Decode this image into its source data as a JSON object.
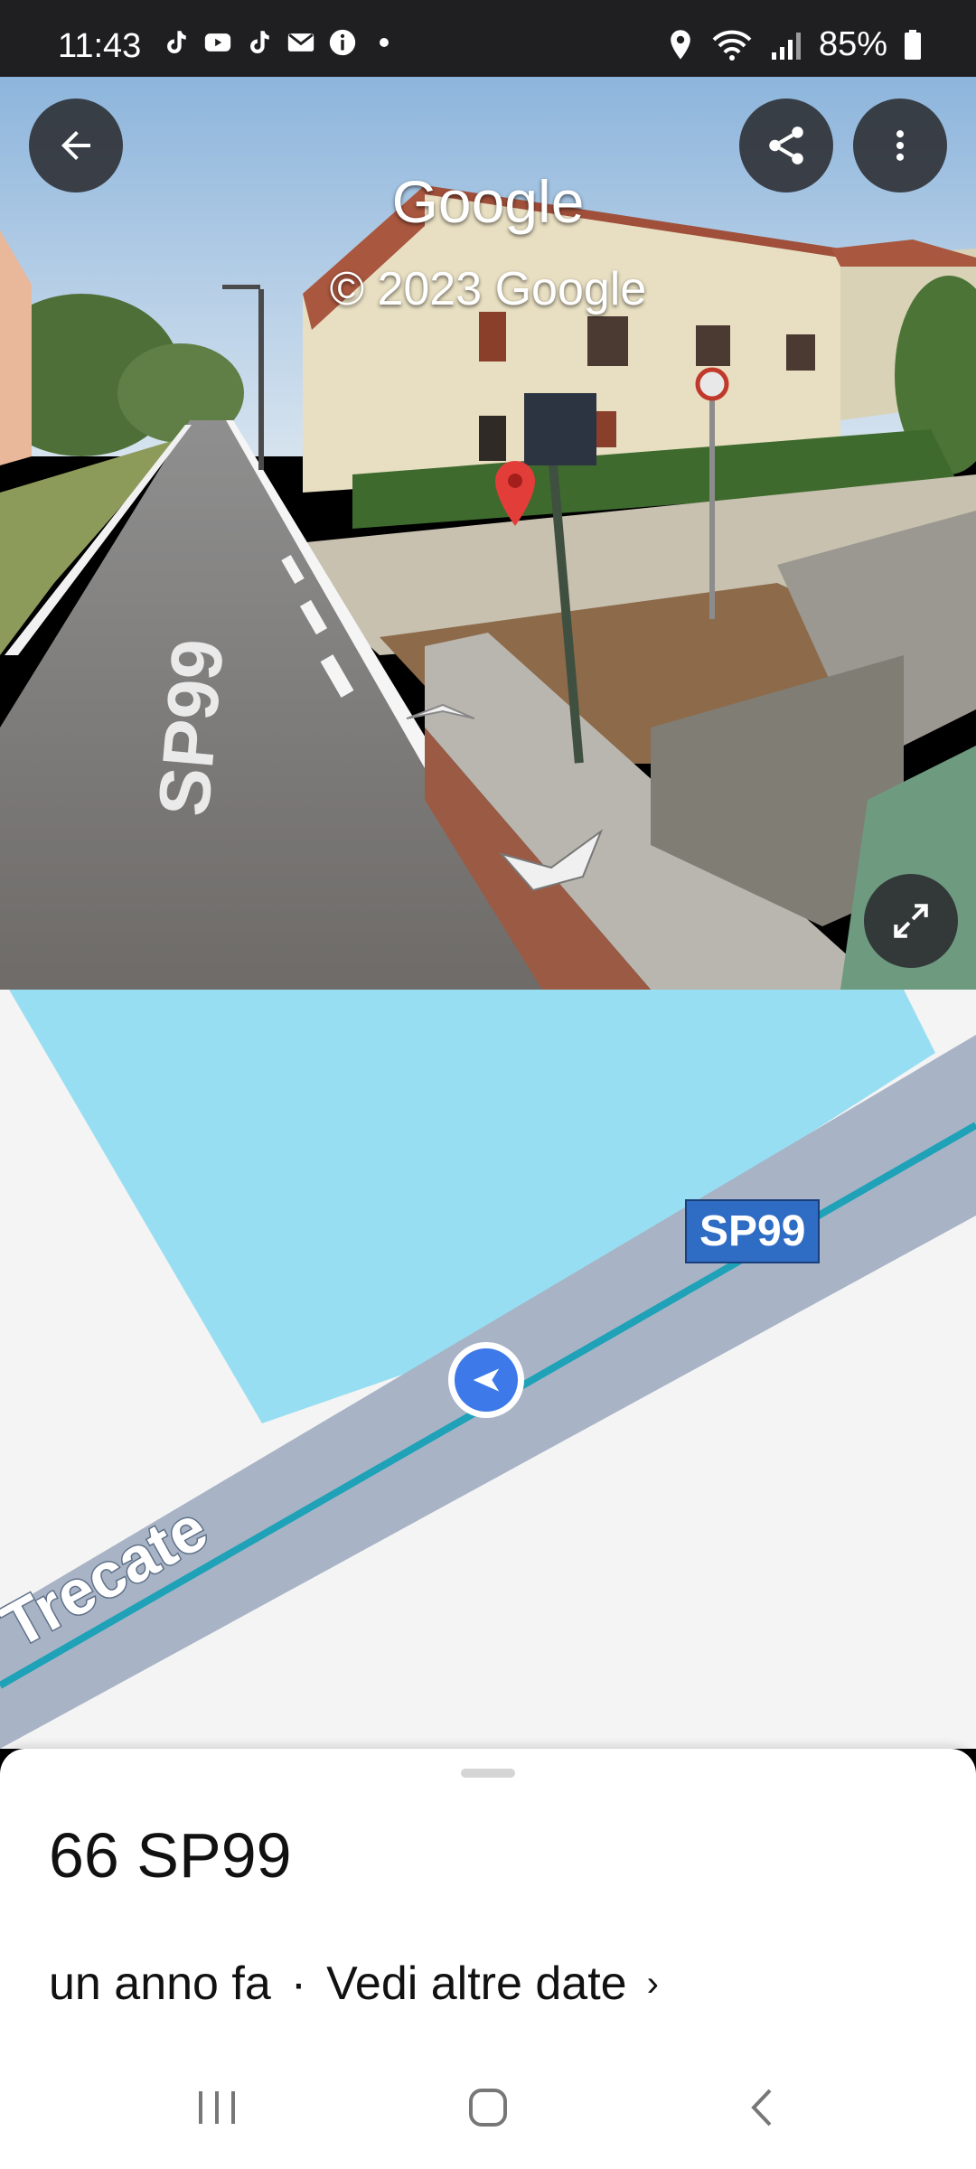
{
  "status_bar": {
    "time": "11:43",
    "battery": "85%",
    "notification_icons": [
      "tiktok-icon",
      "youtube-icon",
      "tiktok-icon",
      "mail-icon",
      "info-icon",
      "dot-icon"
    ],
    "status_icons": [
      "location-icon",
      "wifi-icon",
      "signal-icon",
      "battery-icon"
    ]
  },
  "street_view": {
    "title": "Google",
    "copyright": "© 2023 Google",
    "road_marking": "SP99",
    "buttons": [
      "back-icon",
      "share-icon",
      "more-icon",
      "expand-icon"
    ]
  },
  "map": {
    "road_label": "SP99",
    "street_name": "Trecate",
    "colors": {
      "water": "#98def2",
      "road": "#a8b4c6",
      "route": "#1fa2b8",
      "marker": "#3d79e8",
      "label": "#2f6cc4"
    }
  },
  "sheet": {
    "address": "66 SP99",
    "date_text": "un anno fa",
    "separator": "·",
    "see_more": "Vedi altre date",
    "chevron": "›"
  },
  "nav": {
    "buttons": [
      "recents-icon",
      "home-icon",
      "back-nav-icon"
    ]
  }
}
